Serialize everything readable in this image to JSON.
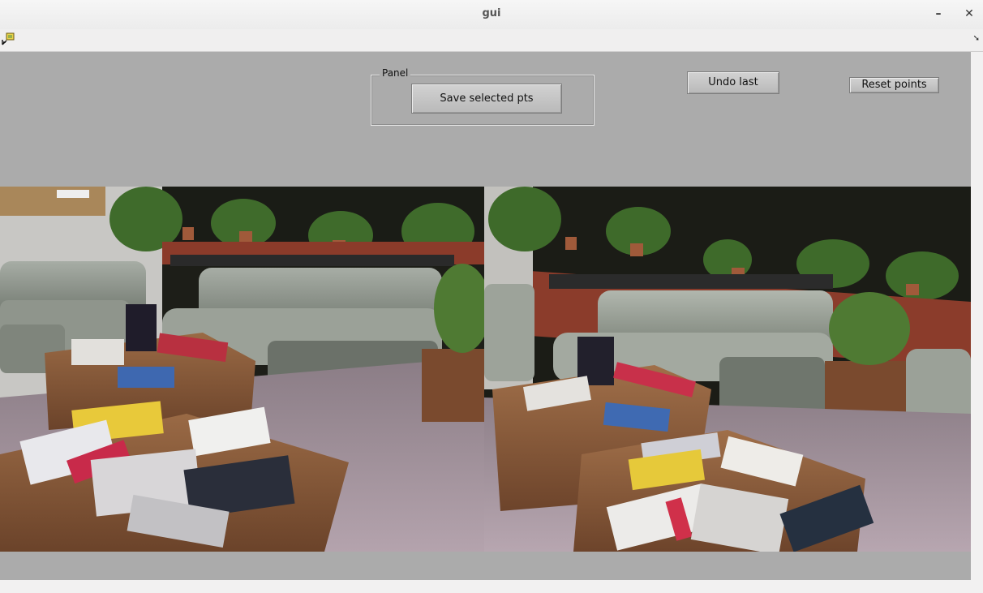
{
  "window": {
    "title": "gui",
    "minimize_glyph": "–",
    "close_glyph": "✕"
  },
  "toolbar": {
    "icons": [
      "insert-icon",
      "corner-arrow-icon"
    ],
    "corner_glyph": "➘"
  },
  "panel": {
    "title": "Panel",
    "save_button_label": "Save selected pts"
  },
  "controls": {
    "undo_label": "Undo last",
    "reset_label": "Reset points"
  },
  "images": [
    {
      "name": "left-view",
      "subject": "lounge with grey sofas, plants and books on wooden tables"
    },
    {
      "name": "right-view",
      "subject": "same lounge from a shifted viewpoint"
    }
  ],
  "colors": {
    "figure_background": "#ababab",
    "window_background": "#f2f1f1"
  }
}
